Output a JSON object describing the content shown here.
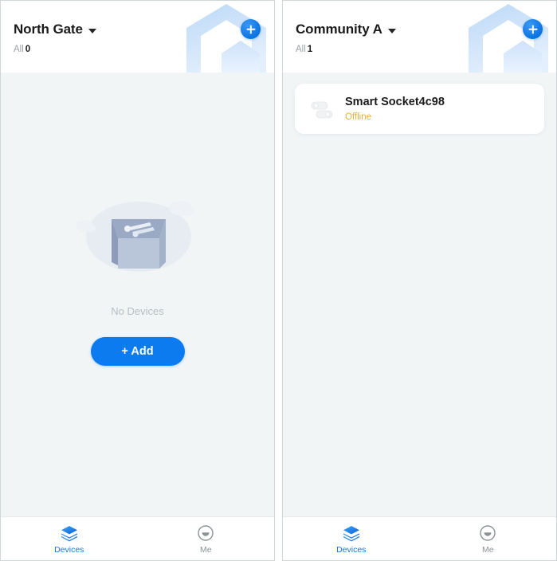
{
  "app": {
    "background_color": "#f1f5f6",
    "accent_color": "#0d7bf0",
    "offline_color": "#deb23c"
  },
  "screens": [
    {
      "header": {
        "title": "North Gate",
        "caret_icon": "chevron-down-icon",
        "filter_label": "All",
        "count": "0",
        "add_icon": "plus-icon",
        "watermark_icon": "house-outline-icon"
      },
      "empty_state": {
        "illustration_icon": "empty-box-icon",
        "text": "No Devices",
        "add_button_label": "+ Add"
      },
      "devices": [],
      "bottom_nav": [
        {
          "label": "Devices",
          "icon": "layers-icon",
          "active": true
        },
        {
          "label": "Me",
          "icon": "account-circle-icon",
          "active": false
        }
      ]
    },
    {
      "header": {
        "title": "Community A",
        "caret_icon": "chevron-down-icon",
        "filter_label": "All",
        "count": "1",
        "add_icon": "plus-icon",
        "watermark_icon": "house-outline-icon"
      },
      "empty_state": null,
      "devices": [
        {
          "name": "Smart Socket4c98",
          "status": "Offline",
          "icon": "smart-socket-icon"
        }
      ],
      "bottom_nav": [
        {
          "label": "Devices",
          "icon": "layers-icon",
          "active": true
        },
        {
          "label": "Me",
          "icon": "account-circle-icon",
          "active": false
        }
      ]
    }
  ]
}
